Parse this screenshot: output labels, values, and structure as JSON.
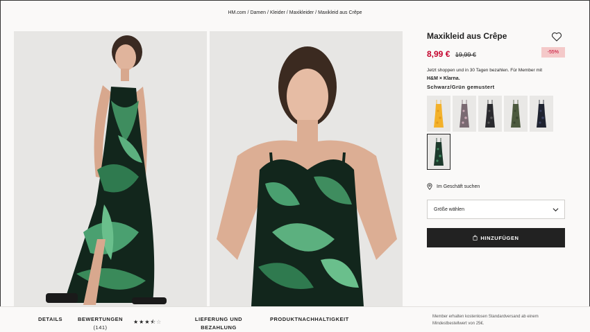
{
  "breadcrumb": {
    "items": [
      "HM.com",
      "Damen",
      "Kleider",
      "Maxikleider",
      "Maxikleid aus Crêpe"
    ],
    "separator": "/"
  },
  "product": {
    "title": "Maxikleid aus Crêpe",
    "price_new": "8,99 €",
    "price_old": "19,99 €",
    "discount": "-55%",
    "klarna_text": "Jetzt shoppen und in 30 Tagen bezahlen. Für Member mit",
    "klarna_logo": "H&M × Klarna.",
    "color_name": "Schwarz/Grün gemustert",
    "store_search": "Im Geschäft suchen",
    "size_placeholder": "Größe wählen",
    "add_button": "HINZUFÜGEN",
    "icons": [
      "heart-icon",
      "location-pin-icon",
      "chevron-down-icon",
      "shopping-bag-icon"
    ]
  },
  "swatches": [
    {
      "color": "#f3b12a",
      "pattern": "#e49a1a"
    },
    {
      "color": "#7a6a72",
      "pattern": "#c9a7b4"
    },
    {
      "color": "#2a2a2e",
      "pattern": "#555"
    },
    {
      "color": "#4c5a3e",
      "pattern": "#3a4630"
    },
    {
      "color": "#1f2330",
      "pattern": "#3a4060"
    },
    {
      "color": "#1d3a2c",
      "pattern": "#3f8a5e",
      "selected": true
    }
  ],
  "tabs": {
    "details": "DETAILS",
    "reviews": "BEWERTUNGEN",
    "reviews_count": "(141)",
    "rating": 3.5,
    "delivery": "LIEFERUNG UND BEZAHLUNG",
    "sustainability": "PRODUKTNACHHALTIGKEIT"
  },
  "member_note": "Member erhalten kostenlosen Standardversand ab einem Mindestbestellwert von 25€.",
  "colors": {
    "accent": "#c4002b",
    "discount_bg": "#f4c9c9",
    "button_bg": "#222222",
    "page_bg": "#faf9f8",
    "photo_bg": "#e7e6e4"
  }
}
